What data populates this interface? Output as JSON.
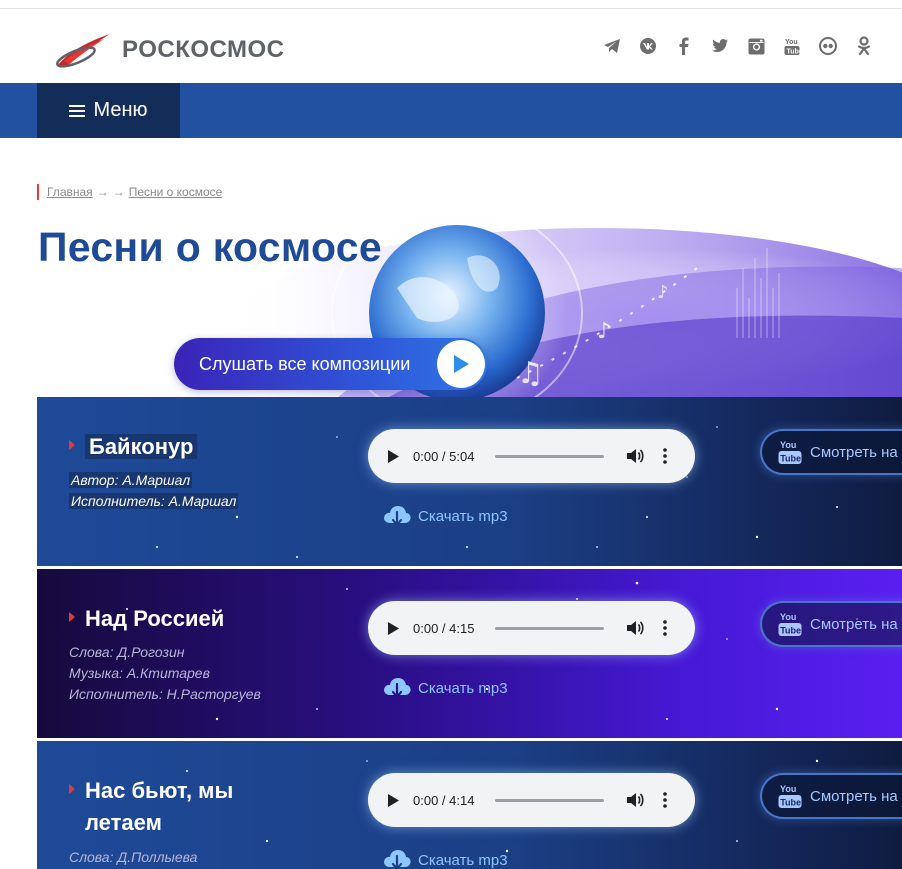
{
  "header": {
    "logo_text": "РОСКОСМОС",
    "socials": [
      "telegram-icon",
      "vk-icon",
      "facebook-icon",
      "twitter-icon",
      "instagram-icon",
      "youtube-icon",
      "flickr-icon",
      "odnoklassniki-icon"
    ]
  },
  "nav": {
    "menu_label": "Меню"
  },
  "breadcrumb": {
    "home": "Главная",
    "sep1": "→",
    "sep2": "→",
    "current": "Песни о космосе"
  },
  "page": {
    "title": "Песни о космосе",
    "listen_all": "Слушать все композиции"
  },
  "songs": [
    {
      "title": "Байконур",
      "meta": [
        "Автор: А.Маршал",
        "Исполнитель: А.Маршал"
      ],
      "time": "0:00 / 5:04",
      "download": "Скачать mp3",
      "watch": "Смотреть на"
    },
    {
      "title": "Над Россией",
      "meta": [
        "Слова: Д.Рогозин",
        "Музыка: А.Ктитарев",
        "Исполнитель: Н.Расторгуев"
      ],
      "time": "0:00 / 4:15",
      "download": "Скачать mp3",
      "watch": "Смотреть на"
    },
    {
      "title_line1": "Нас бьют, мы",
      "title_line2": "летаем",
      "meta": [
        "Слова: Д.Поллыева"
      ],
      "time": "0:00 / 4:14",
      "download": "Скачать mp3",
      "watch": "Смотреть на"
    }
  ],
  "colors": {
    "brand_blue": "#2351a2",
    "menu_dark": "#142d58",
    "title_blue": "#1f4b96",
    "accent_red": "#e53935"
  }
}
